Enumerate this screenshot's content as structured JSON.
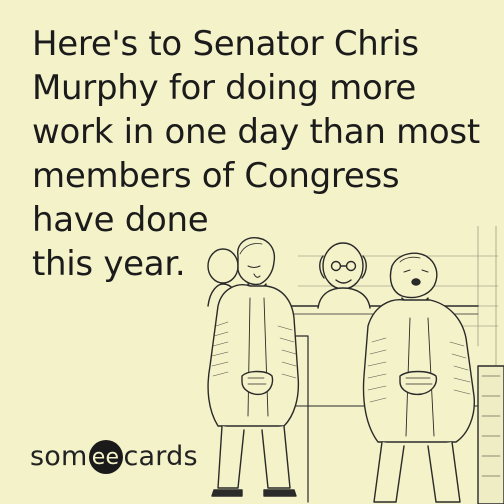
{
  "caption": {
    "lines": [
      "Here's to Senator Chris",
      "Murphy for doing more",
      "work in one day than most",
      "members of Congress",
      "have done",
      "this year."
    ]
  },
  "logo": {
    "text": "someecards",
    "pre": "som",
    "mid": "ee",
    "post": "cards"
  },
  "colors": {
    "background": "#f4f2c9",
    "text": "#1b1b1b",
    "logo_badge": "#1a1a1a"
  }
}
